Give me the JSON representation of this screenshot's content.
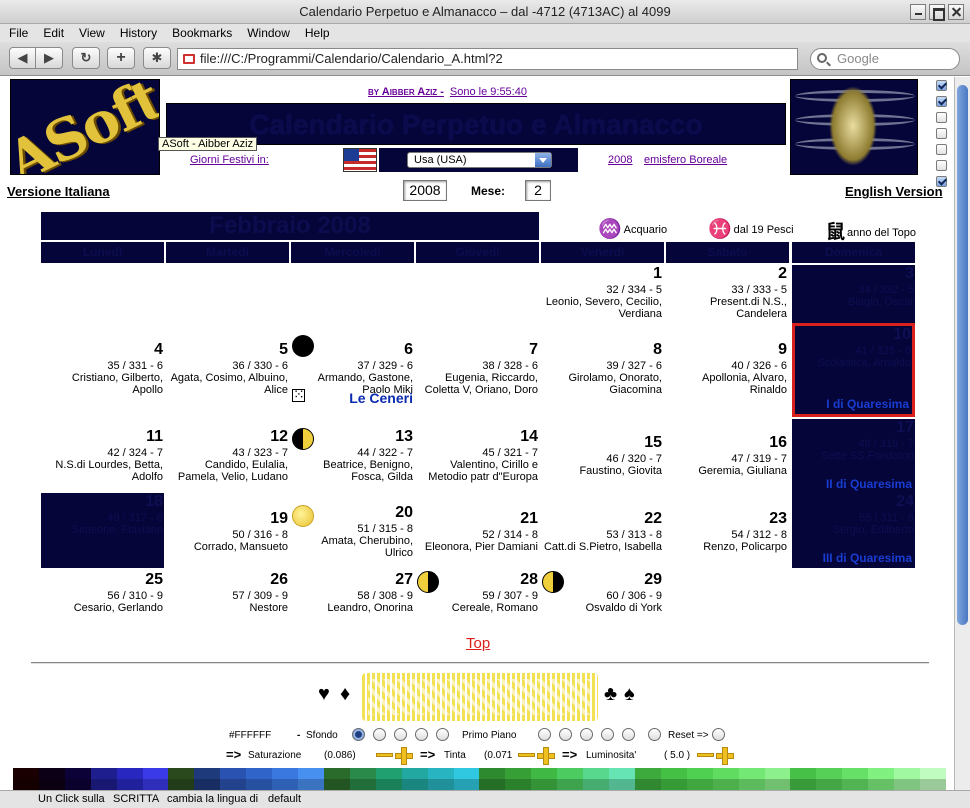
{
  "window": {
    "title": "Calendario Perpetuo e Almanacco – dal -4712 (4713AC) al 4099"
  },
  "menu": [
    "File",
    "Edit",
    "View",
    "History",
    "Bookmarks",
    "Window",
    "Help"
  ],
  "toolbar": {
    "url": "file:///C:/Programmi/Calendario/Calendario_A.html?2",
    "search_placeholder": "Google",
    "reload_icon": "reload-icon",
    "add_icon": "plus-icon",
    "bug_icon": "bug-icon"
  },
  "header": {
    "logo_text": "ASoft",
    "tooltip": "ASoft - Aibber Aziz",
    "by_label": "by Aibber Aziz -",
    "clock": "Sono le 9:55:40",
    "page_title": "Calendario Perpetuo e Almanacco",
    "festivi_label": "Giorni Festivi in:",
    "country": "Usa (USA)",
    "year_link": "2008",
    "hemisphere": "emisfero Boreale"
  },
  "controls": {
    "lang_it": "Versione Italiana",
    "lang_en": "English Version",
    "year": "2008",
    "mese_label": "Mese:",
    "month": "2"
  },
  "calendar": {
    "month_title": "Febbraio 2008",
    "sign": {
      "glyph": "♒",
      "text": "Acquario"
    },
    "sign_next": {
      "glyph": "♓",
      "text": "dal 19 Pesci"
    },
    "chinese": {
      "glyph": "鼠",
      "text": "anno del Topo"
    },
    "weekdays": [
      "Lunedì",
      "Martedì",
      "Mercoledì",
      "Giovedì",
      "Venerdì",
      "Sabato",
      "Domenica"
    ],
    "days": [
      {
        "n": "1",
        "dy": "32 / 334 - 5",
        "saints": "Leonio, Severo, Cecilio, Verdiana"
      },
      {
        "n": "2",
        "dy": "33 / 333 - 5",
        "saints": "Present.di N.S., Candelera"
      },
      {
        "n": "3",
        "dy": "34 / 332 - 5",
        "saints": "Biagio, Oscar"
      },
      {
        "n": "4",
        "dy": "35 / 331 - 6",
        "saints": "Cristiano, Gilberto, Apollo"
      },
      {
        "n": "5",
        "dy": "36 / 330 - 6",
        "saints": "Agata, Cosimo, Albuino, Alice"
      },
      {
        "n": "6",
        "dy": "37 / 329 - 6",
        "saints": "Armando, Gastone, Paolo Miki",
        "holiday": "Le Ceneri"
      },
      {
        "n": "7",
        "dy": "38 / 328 - 6",
        "saints": "Eugenia, Riccardo, Coletta V, Oriano, Doro"
      },
      {
        "n": "8",
        "dy": "39 / 327 - 6",
        "saints": "Girolamo, Onorato, Giacomina"
      },
      {
        "n": "9",
        "dy": "40 / 326 - 6",
        "saints": "Apollonia, Alvaro, Rinaldo"
      },
      {
        "n": "10",
        "dy": "41 / 325 - 6",
        "saints": "Scolastica, Arnaldo",
        "fest": "I di Quaresima"
      },
      {
        "n": "11",
        "dy": "42 / 324 - 7",
        "saints": "N.S.di Lourdes, Betta, Adolfo"
      },
      {
        "n": "12",
        "dy": "43 / 323 - 7",
        "saints": "Candido, Eulalia, Pamela, Velio, Ludano"
      },
      {
        "n": "13",
        "dy": "44 / 322 - 7",
        "saints": "Beatrice, Benigno, Fosca, Gilda"
      },
      {
        "n": "14",
        "dy": "45 / 321 - 7",
        "saints": "Valentino, Cirillo e Metodio patr d\"Europa"
      },
      {
        "n": "15",
        "dy": "46 / 320 - 7",
        "saints": "Faustino, Giovita"
      },
      {
        "n": "16",
        "dy": "47 / 319 - 7",
        "saints": "Geremia, Giuliana"
      },
      {
        "n": "17",
        "dy": "48 / 318 - 7",
        "saints": "Sette SS.Fondatori",
        "fest": "II di Quaresima"
      },
      {
        "n": "18",
        "dy": "49 / 317 - 8",
        "saints": "Simeone, Flaviano"
      },
      {
        "n": "19",
        "dy": "50 / 316 - 8",
        "saints": "Corrado, Mansueto"
      },
      {
        "n": "20",
        "dy": "51 / 315 - 8",
        "saints": "Amata, Cherubino, Ulrico"
      },
      {
        "n": "21",
        "dy": "52 / 314 - 8",
        "saints": "Eleonora, Pier Damiani"
      },
      {
        "n": "22",
        "dy": "53 / 313 - 8",
        "saints": "Catt.di S.Pietro, Isabella"
      },
      {
        "n": "23",
        "dy": "54 / 312 - 8",
        "saints": "Renzo, Policarpo"
      },
      {
        "n": "24",
        "dy": "55 / 311 - 8",
        "saints": "Sergio, Edilberto",
        "fest": "III di Quaresima"
      },
      {
        "n": "25",
        "dy": "56 / 310 - 9",
        "saints": "Cesario, Gerlando"
      },
      {
        "n": "26",
        "dy": "57 / 309 - 9",
        "saints": "Nestore"
      },
      {
        "n": "27",
        "dy": "58 / 308 - 9",
        "saints": "Leandro, Onorina"
      },
      {
        "n": "28",
        "dy": "59 / 307 - 9",
        "saints": "Cereale, Romano"
      },
      {
        "n": "29",
        "dy": "60 / 306 - 9",
        "saints": "Osvaldo di York"
      }
    ]
  },
  "top_link": "Top",
  "colors": {
    "hex": "#FFFFFF",
    "sfondo": "Sfondo",
    "primo_piano": "Primo Piano",
    "reset": "Reset =>",
    "arrow": "=>",
    "saturazione": "Saturazione",
    "sat_value": "(0.086)",
    "tinta": "Tinta",
    "tinta_value": "(0.071",
    "luminosita": "Luminosita'",
    "lum_value": "( 5.0 )",
    "palette": [
      "#1a0000",
      "#0c0016",
      "#0c0238",
      "#1e1e8e",
      "#2828c0",
      "#3a3ae8",
      "#2a4a1e",
      "#1e3a7a",
      "#2a52b0",
      "#3064c8",
      "#3a78e0",
      "#4890f0",
      "#2a6a2a",
      "#2a8a4a",
      "#20a070",
      "#22a8a0",
      "#28b4c0",
      "#30c8e0",
      "#2e8a2e",
      "#36a036",
      "#40b844",
      "#4ccc60",
      "#58d88c",
      "#66e4b4",
      "#3caa3c",
      "#44c044",
      "#50d050",
      "#60dc60",
      "#74e874",
      "#8cf08c",
      "#46c046",
      "#56d056",
      "#66e066",
      "#80f080",
      "#a0f8a0",
      "#c0fcc0"
    ]
  },
  "status": {
    "s1": "Un Click sulla",
    "s2": "SCRITTA",
    "s3": "cambia la lingua di",
    "s4": "default"
  }
}
